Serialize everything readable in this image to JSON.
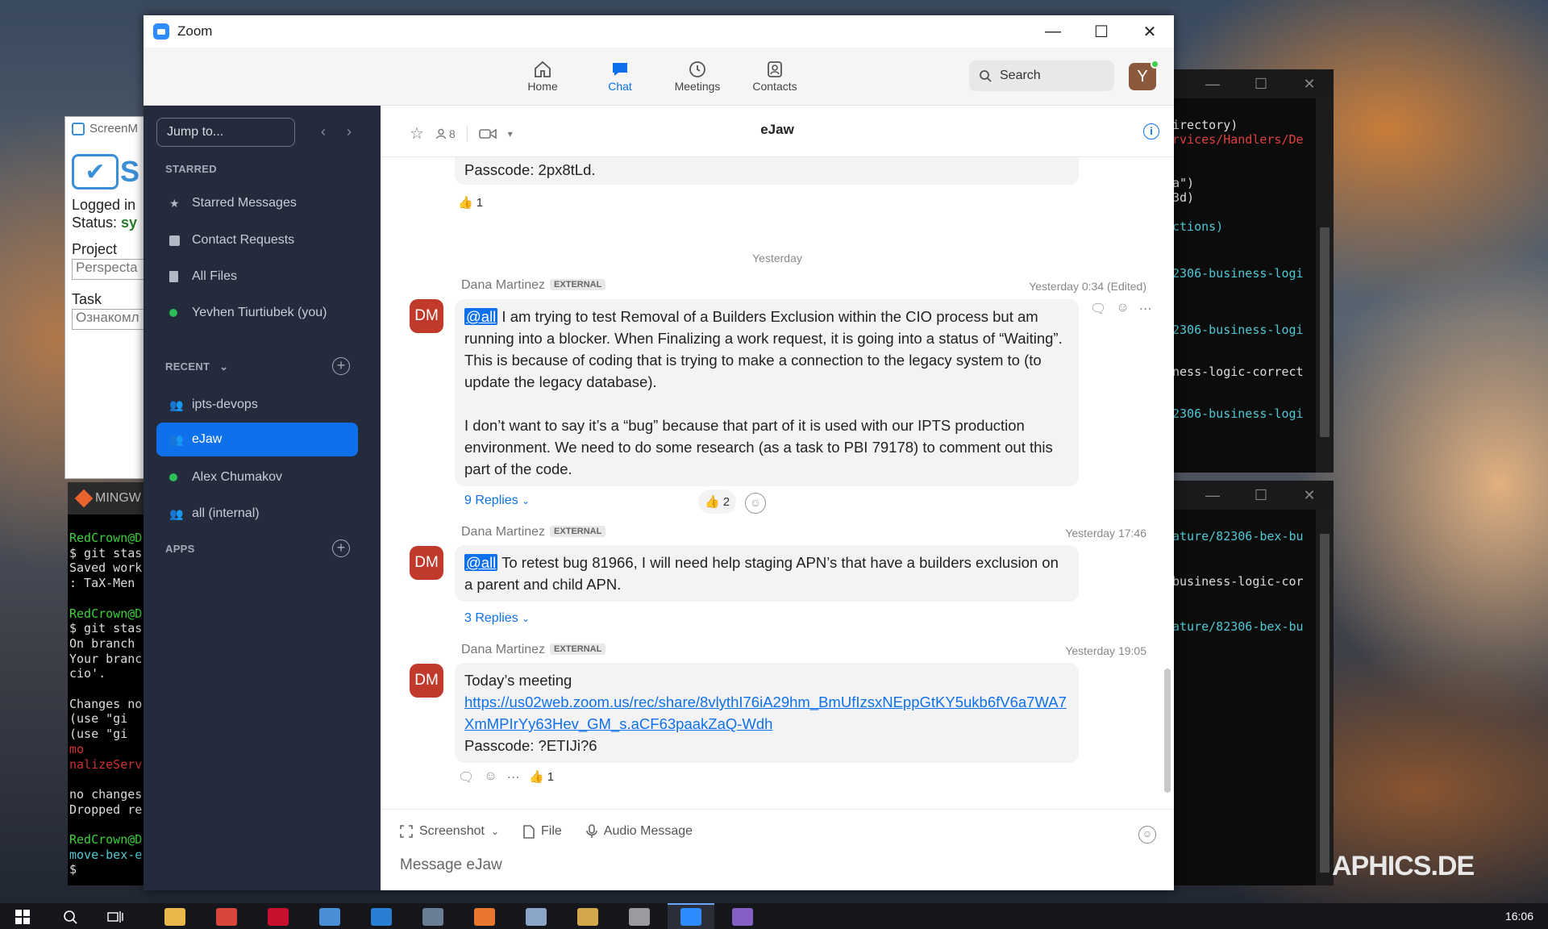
{
  "desktop": {
    "terminal_top_lines": [
      {
        "text": "irectory)",
        "color": "#dddddd"
      },
      {
        "text": "rvices/Handlers/De",
        "color": "#e04040"
      },
      {
        "text": "a\")",
        "color": "#dddddd"
      },
      {
        "text": "3d)",
        "color": "#dddddd"
      },
      {
        "text": "ctions)",
        "color": "#4ec9d6"
      },
      {
        "text": "2306-business-logi",
        "color": "#4ec9d6"
      },
      {
        "text": "2306-business-logi",
        "color": "#4ec9d6"
      },
      {
        "text": "ness-logic-correct",
        "color": "#dddddd"
      },
      {
        "text": "2306-business-logi",
        "color": "#4ec9d6"
      }
    ],
    "terminal_bottom_lines": [
      {
        "text": "ature/82306-bex-bu",
        "color": "#4ec9d6"
      },
      {
        "text": "business-logic-cor",
        "color": "#dddddd"
      },
      {
        "text": "ature/82306-bex-bu",
        "color": "#4ec9d6"
      }
    ],
    "screenmonitor": {
      "title": "ScreenM",
      "logo_text": "S",
      "logged_in": "Logged in",
      "status_label": "Status:",
      "status_value": "sy",
      "project_label": "Project",
      "project_value": "Perspecta",
      "task_label": "Task",
      "task_value": "Ознакомл"
    },
    "mingw": {
      "title": "MINGW",
      "lines": [
        {
          "text": "RedCrown@D",
          "color": "#3cd13c"
        },
        {
          "text": "$ git stas",
          "color": "#dddddd"
        },
        {
          "text": "Saved work",
          "color": "#dddddd"
        },
        {
          "text": ": TaX-Men",
          "color": "#dddddd"
        },
        {
          "text": "",
          "color": "#dddddd"
        },
        {
          "text": "RedCrown@D",
          "color": "#3cd13c"
        },
        {
          "text": "$ git stas",
          "color": "#dddddd"
        },
        {
          "text": "On branch",
          "color": "#dddddd"
        },
        {
          "text": "Your branc",
          "color": "#dddddd"
        },
        {
          "text": "cio'.",
          "color": "#dddddd"
        },
        {
          "text": "",
          "color": "#dddddd"
        },
        {
          "text": "Changes no",
          "color": "#dddddd"
        },
        {
          "text": "  (use \"gi",
          "color": "#dddddd"
        },
        {
          "text": "  (use \"gi",
          "color": "#dddddd"
        },
        {
          "text": "        mo",
          "color": "#d03030"
        },
        {
          "text": "nalizeServ",
          "color": "#d03030"
        },
        {
          "text": "",
          "color": "#dddddd"
        },
        {
          "text": "no changes",
          "color": "#dddddd"
        },
        {
          "text": "Dropped re",
          "color": "#dddddd"
        },
        {
          "text": "",
          "color": "#dddddd"
        },
        {
          "text": "RedCrown@D",
          "color": "#3cd13c"
        },
        {
          "text": "move-bex-e",
          "color": "#4ec9d6"
        },
        {
          "text": "$ ",
          "color": "#dddddd"
        }
      ]
    },
    "watermark": "APHICS.DE",
    "clock": "16:06"
  },
  "zoom": {
    "title": "Zoom",
    "window_controls": [
      "—",
      "☐",
      "✕"
    ],
    "nav": [
      {
        "label": "Home",
        "icon": "home-icon"
      },
      {
        "label": "Chat",
        "icon": "chat-icon",
        "active": true
      },
      {
        "label": "Meetings",
        "icon": "clock-icon"
      },
      {
        "label": "Contacts",
        "icon": "contacts-icon"
      }
    ],
    "search_label": "Search",
    "avatar_letter": "Y",
    "sidebar": {
      "jump_placeholder": "Jump to...",
      "starred_header": "STARRED",
      "starred": [
        {
          "label": "Starred Messages",
          "icon": "star-icon"
        },
        {
          "label": "Contact Requests",
          "icon": "contact-request-icon"
        },
        {
          "label": "All Files",
          "icon": "file-icon"
        },
        {
          "label": "Yevhen Tiurtiubek (you)",
          "icon": "online-dot"
        }
      ],
      "recent_header": "RECENT",
      "recent": [
        {
          "label": "ipts-devops",
          "icon": "group-icon"
        },
        {
          "label": "eJaw",
          "icon": "group-icon",
          "active": true
        },
        {
          "label": "Alex Chumakov",
          "icon": "online-dot"
        },
        {
          "label": "all (internal)",
          "icon": "group-icon"
        }
      ],
      "apps_header": "APPS"
    },
    "chat": {
      "title": "eJaw",
      "member_count": "8",
      "prev_passcode": "Passcode: 2px8tLd.",
      "prev_reaction_count": "1",
      "day_separator": "Yesterday",
      "messages": [
        {
          "sender": "Dana Martinez",
          "badge": "EXTERNAL",
          "initials": "DM",
          "time": "Yesterday 0:34 (Edited)",
          "mention": "@all",
          "text1": " I am trying to test Removal of a Builders Exclusion within the CIO process but am running into a blocker. When Finalizing a work request, it is going into a status of “Waiting”. This is because of coding that is trying to make a connection to the legacy system to (to update the legacy database).",
          "text2": "I don’t want to say it’s a “bug” because that part of it is used with our IPTS production environment. We need to do some research (as a task to PBI 79178) to comment out this part of the code.",
          "replies": "9 Replies",
          "reaction_count": "2"
        },
        {
          "sender": "Dana Martinez",
          "badge": "EXTERNAL",
          "initials": "DM",
          "time": "Yesterday 17:46",
          "mention": "@all",
          "text1": " To retest bug 81966, I  will need help staging APN’s that have a builders exclusion on a parent and child APN.",
          "replies": "3 Replies"
        },
        {
          "sender": "Dana Martinez",
          "badge": "EXTERNAL",
          "initials": "DM",
          "time": "Yesterday 19:05",
          "text1": "Today’s meeting",
          "link": "https://us02web.zoom.us/rec/share/8vlythI76iA29hm_BmUfIzsxNEppGtKY5ukb6fV6a7WA7XmMPIrYy63Hev_GM_s.aCF63paakZaQ-Wdh",
          "passcode": "Passcode: ?ETIJi?6",
          "reaction_count": "1"
        }
      ],
      "composer": {
        "screenshot": "Screenshot",
        "file": "File",
        "audio": "Audio Message",
        "placeholder": "Message eJaw"
      }
    }
  },
  "taskbar": {
    "apps": [
      {
        "icon": "file-explorer-icon",
        "color": "#e8b84a"
      },
      {
        "icon": "chrome-icon",
        "color": "#d9453b"
      },
      {
        "icon": "opera-icon",
        "color": "#c8102e"
      },
      {
        "icon": "screenmonitor-icon",
        "color": "#4a8fd6"
      },
      {
        "icon": "skype-icon",
        "color": "#2a7fd4"
      },
      {
        "icon": "app-window-icon",
        "color": "#6a7e96"
      },
      {
        "icon": "firefox-icon",
        "color": "#e8762c"
      },
      {
        "icon": "notepad-icon",
        "color": "#8aa6c6"
      },
      {
        "icon": "paint-icon",
        "color": "#d4a84a"
      },
      {
        "icon": "editor-icon",
        "color": "#9a9aa0"
      },
      {
        "icon": "zoom-icon",
        "color": "#2D8CFF",
        "active": true
      },
      {
        "icon": "visual-studio-icon",
        "color": "#865fc5"
      }
    ]
  }
}
